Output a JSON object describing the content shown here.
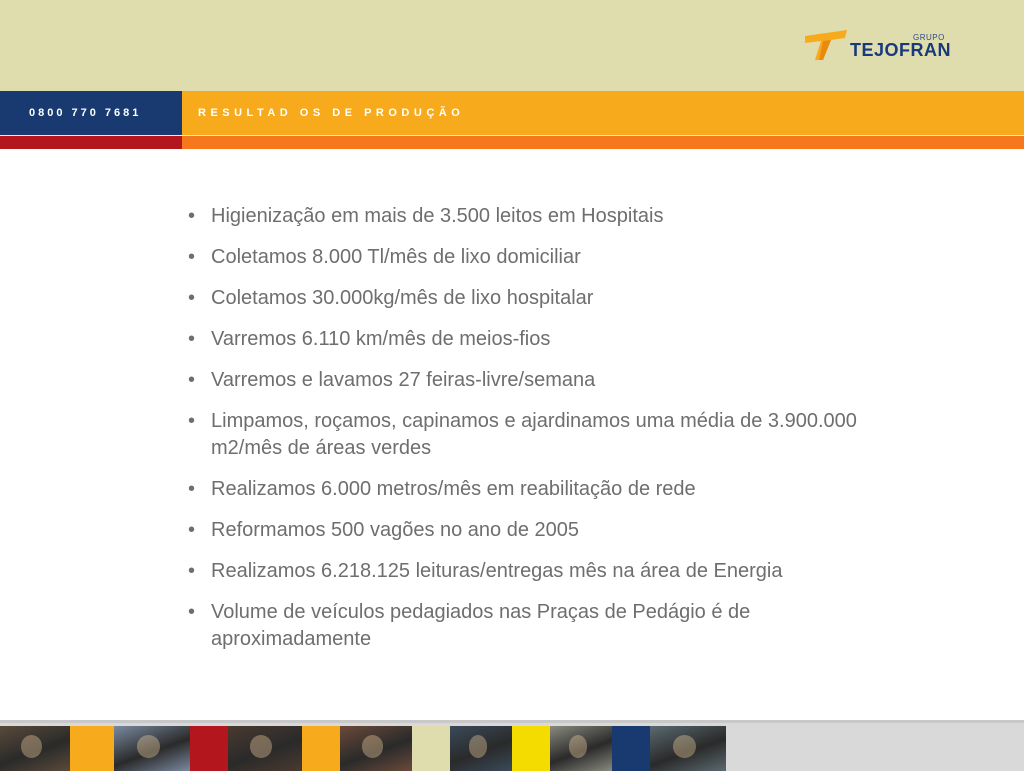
{
  "brand": {
    "group_label": "GRUPO",
    "name": "TEJOFRAN"
  },
  "header": {
    "phone": "0800 770 7681",
    "section_title": "RESULTAD OS  DE  PRODUÇÃO"
  },
  "bullets": [
    "Higienização em mais de 3.500 leitos em Hospitais",
    "Coletamos 8.000 Tl/mês de lixo domiciliar",
    "Coletamos 30.000kg/mês de lixo hospitalar",
    "Varremos 6.110 km/mês  de meios-fios",
    "Varremos e lavamos 27 feiras-livre/semana",
    "Limpamos, roçamos, capinamos e ajardinamos uma média de 3.900.000 m2/mês de áreas verdes",
    "Realizamos 6.000 metros/mês em reabilitação de rede",
    "Reformamos 500 vagões no ano de 2005",
    "Realizamos 6.218.125 leituras/entregas mês na área de Energia",
    "Volume de veículos pedagiados nas Praças de Pedágio é de aproximadamente"
  ],
  "bullet_glyph": "•",
  "colors": {
    "top_band": "#dfdcae",
    "navy": "#183a70",
    "orange": "#f7ab1c",
    "red": "#b3161c",
    "dark_orange": "#f7771d",
    "text": "#6e6e6e"
  },
  "photo_strip": {
    "tiles": [
      {
        "type": "photo",
        "subject": "welding-worker",
        "color": "#5a4a3a"
      },
      {
        "type": "color",
        "color": "#f7ab1c"
      },
      {
        "type": "photo",
        "subject": "mechanic-worker",
        "color": "#7a8aa0"
      },
      {
        "type": "color",
        "color": "#b3161c"
      },
      {
        "type": "photo",
        "subject": "welder-mask",
        "color": "#4a3a30"
      },
      {
        "type": "color",
        "color": "#f7ab1c"
      },
      {
        "type": "photo",
        "subject": "smiling-worker",
        "color": "#6a4a3a"
      },
      {
        "type": "color",
        "color": "#dfdcae"
      },
      {
        "type": "photo",
        "subject": "machinery",
        "color": "#3a4a5a"
      },
      {
        "type": "color",
        "color": "#f5dc00"
      },
      {
        "type": "photo",
        "subject": "construction-worker",
        "color": "#8a8a80"
      },
      {
        "type": "color",
        "color": "#183a70"
      },
      {
        "type": "photo",
        "subject": "street-cleaner",
        "color": "#5a6a70"
      }
    ]
  }
}
